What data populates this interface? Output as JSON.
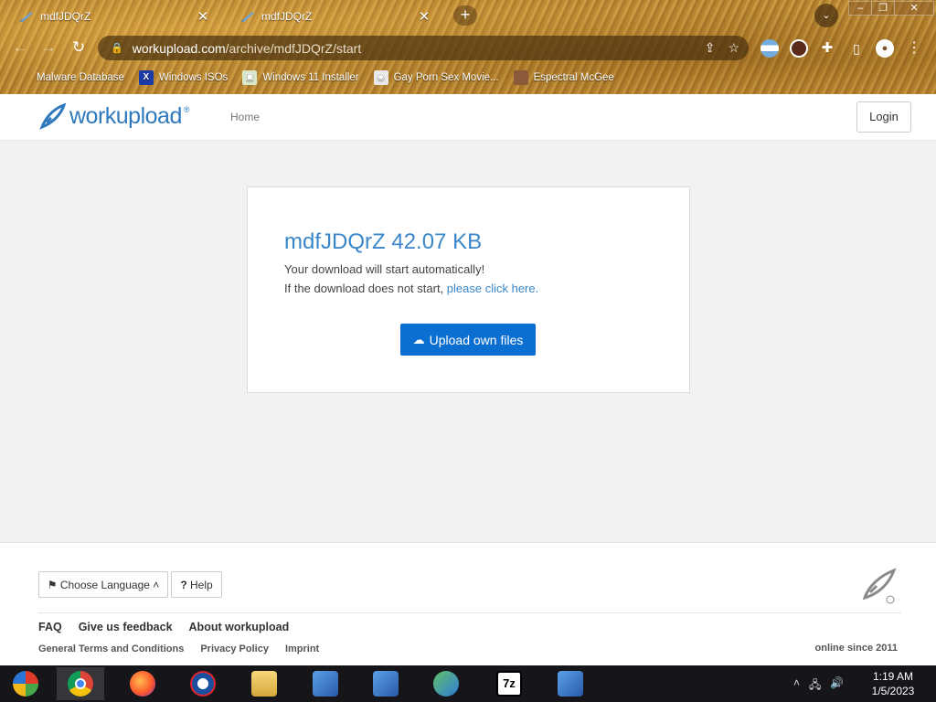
{
  "browser": {
    "tabs": [
      {
        "title": "mdfJDQrZ",
        "close": "✕"
      },
      {
        "title": "mdfJDQrZ",
        "close": "✕"
      }
    ],
    "new_tab": "+",
    "tab_search": "⌄",
    "window_controls": {
      "minimize": "–",
      "maximize": "❐",
      "close": "✕"
    },
    "nav": {
      "back": "←",
      "forward": "→",
      "reload": "↻"
    },
    "url": {
      "host": "workupload.com",
      "path": "/archive/mdfJDQrZ/start"
    },
    "bookmarks": [
      {
        "label": "Malware Database",
        "icon": "malware-icon"
      },
      {
        "label": "Windows ISOs",
        "icon": "x-icon"
      },
      {
        "label": "Windows 11 Installer",
        "icon": "image-icon"
      },
      {
        "label": "Gay Porn Sex Movie...",
        "icon": "disk-icon"
      },
      {
        "label": "Espectral McGee",
        "icon": "face-icon"
      }
    ]
  },
  "site": {
    "logo_text": "workupload",
    "logo_reg": "®",
    "nav_home": "Home",
    "login": "Login"
  },
  "download": {
    "file_name": "mdfJDQrZ",
    "file_size": "42.07 KB",
    "auto_msg": "Your download will start automatically!",
    "fallback_prefix": "If the download does not start, ",
    "fallback_link": "please click here.",
    "upload_button": "Upload own files"
  },
  "footer": {
    "choose_language": "Choose Language",
    "help": "Help",
    "links_primary": [
      "FAQ",
      "Give us feedback",
      "About workupload"
    ],
    "links_secondary": [
      "General Terms and Conditions",
      "Privacy Policy",
      "Imprint"
    ],
    "online_since": "online since 2011"
  },
  "taskbar": {
    "items": [
      "start-icon",
      "chrome-icon",
      "firefox-icon",
      "obama-icon",
      "file-explorer-icon",
      "installer-icon",
      "installer-icon",
      "people-icon",
      "7zip-icon",
      "installer-icon"
    ],
    "seven_zip_label": "7z",
    "time": "1:19 AM",
    "date": "1/5/2023"
  },
  "colors": {
    "brand_blue": "#2f79bd",
    "link_blue": "#3a86c8",
    "button_blue": "#0a6fd0",
    "taskbar": "#15151a"
  }
}
